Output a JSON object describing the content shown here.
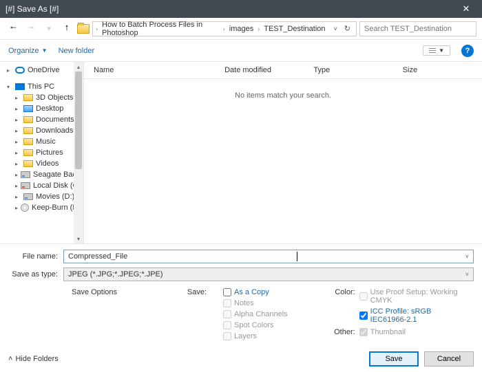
{
  "titlebar": {
    "title": "[#] Save As [#]"
  },
  "nav": {
    "crumb1": "How to Batch Process Files in Photoshop",
    "crumb2": "images",
    "crumb3": "TEST_Destination",
    "search_placeholder": "Search TEST_Destination"
  },
  "toolbar": {
    "organize": "Organize",
    "newfolder": "New folder"
  },
  "sidebar": {
    "onedrive": "OneDrive",
    "thispc": "This PC",
    "items": [
      "3D Objects",
      "Desktop",
      "Documents",
      "Downloads",
      "Music",
      "Pictures",
      "Videos",
      "Seagate Backup",
      "Local Disk (C:)",
      "Movies (D:)",
      "Keep-Burn (F:)"
    ]
  },
  "columns": {
    "name": "Name",
    "date": "Date modified",
    "type": "Type",
    "size": "Size"
  },
  "empty_msg": "No items match your search.",
  "fields": {
    "filename_label": "File name:",
    "filename_value": "Compressed_File",
    "savetype_label": "Save as type:",
    "savetype_value": "JPEG (*.JPG;*.JPEG;*.JPE)"
  },
  "options": {
    "header": "Save Options",
    "save_label": "Save:",
    "as_copy": "As a Copy",
    "notes": "Notes",
    "alpha": "Alpha Channels",
    "spot": "Spot Colors",
    "layers": "Layers",
    "color_label": "Color:",
    "proof": "Use Proof Setup: Working CMYK",
    "icc": "ICC Profile: sRGB IEC61966-2.1",
    "other_label": "Other:",
    "thumbnail": "Thumbnail"
  },
  "footer": {
    "hide": "Hide Folders",
    "save": "Save",
    "cancel": "Cancel"
  }
}
